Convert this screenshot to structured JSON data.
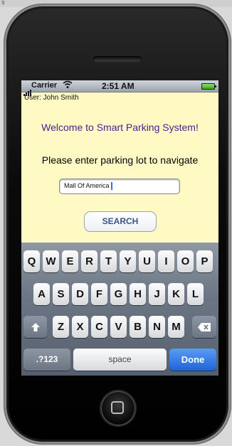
{
  "status_bar": {
    "carrier": "Carrier",
    "wifi_icon": "wifi-icon",
    "time": "2:51 AM",
    "battery_icon": "battery-icon"
  },
  "user_label": "User: John Smith",
  "welcome": "Welcome to Smart Parking System!",
  "prompt": "Please enter parking lot to navigate",
  "lot_input": {
    "value": "Mall Of America"
  },
  "search_label": "SEARCH",
  "keyboard": {
    "row1": [
      "Q",
      "W",
      "E",
      "R",
      "T",
      "Y",
      "U",
      "I",
      "O",
      "P"
    ],
    "row2": [
      "A",
      "S",
      "D",
      "F",
      "G",
      "H",
      "J",
      "K",
      "L"
    ],
    "row3": [
      "Z",
      "X",
      "C",
      "V",
      "B",
      "N",
      "M"
    ],
    "shift_icon": "shift-arrow-icon",
    "backspace_icon": "backspace-icon",
    "numbers_label": ".?123",
    "space_label": "space",
    "done_label": "Done",
    "done_color": "#1f64d8"
  },
  "home_button_icon": "home-square-icon",
  "desktop_fragment": "s"
}
